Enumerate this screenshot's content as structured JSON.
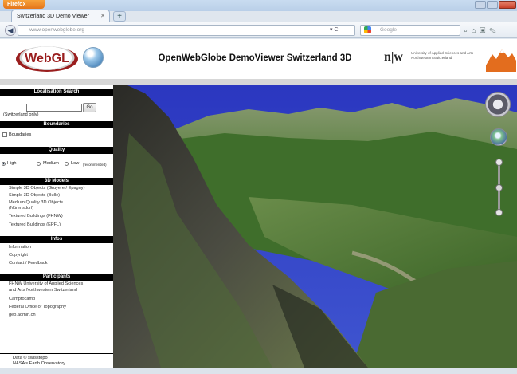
{
  "browser": {
    "menu_button": "Firefox",
    "tab_title": "Switzerland 3D Demo Viewer",
    "new_tab": "+",
    "url": "www.openwebglobe.org",
    "search_placeholder": "Google"
  },
  "header": {
    "logo_text": "WebGL",
    "title": "OpenWebGlobe DemoViewer Switzerland 3D",
    "fhnw_mark": "n|w",
    "fhnw_name": "University of Applied Sciences and Arts Northwestern Switzerland",
    "partner_logo": "camptocamp"
  },
  "sidebar": {
    "localisation": {
      "heading": "Localisation Search",
      "input_value": "",
      "go_label": "Go",
      "hint": "(Switzerland only)"
    },
    "boundaries": {
      "heading": "Boundaries",
      "checkbox_label": "Boundaries"
    },
    "quality": {
      "heading": "Quality",
      "options": [
        "High",
        "Medium",
        "Low"
      ],
      "low_note": "(recommended)",
      "selected": "High"
    },
    "models": {
      "heading": "3D Models",
      "items": [
        "Simple 3D Objects (Gruyere / Epagny)",
        "Simple 3D Objects (Bulle)",
        "Medium Quality 3D Objects",
        "(Nürensdorf)",
        "Textured Buildings (FHNW)",
        "Textured Buildings (EPFL)"
      ]
    },
    "infos": {
      "heading": "Infos",
      "items": [
        "Information",
        "Copyright",
        "Contact / Feedback"
      ]
    },
    "participants": {
      "heading": "Participants",
      "items": [
        "FHNW University of Applied Sciences",
        "and Arts Northwestern Switzerland",
        "Camptocamp",
        "Federal Office of Topography",
        "geo.admin.ch"
      ]
    },
    "credits": [
      "Data © swisstopo",
      "NASA's Earth Observatory"
    ]
  },
  "colors": {
    "section_header": "#000000",
    "webgl_red": "#9a1e1e",
    "sky": "#2f3fc4"
  }
}
